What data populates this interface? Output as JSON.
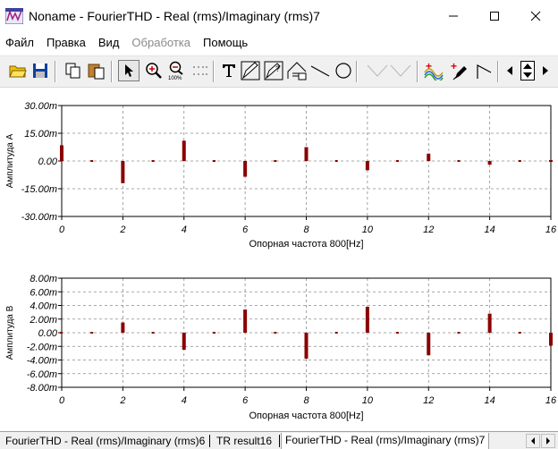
{
  "window": {
    "title": "Noname - FourierTHD - Real (rms)/Imaginary (rms)7",
    "minimize": "—",
    "maximize": "☐",
    "close": "✕"
  },
  "menu": {
    "items": [
      {
        "label": "Файл",
        "enabled": true
      },
      {
        "label": "Правка",
        "enabled": true
      },
      {
        "label": "Вид",
        "enabled": true
      },
      {
        "label": "Обработка",
        "enabled": false
      },
      {
        "label": "Помощь",
        "enabled": true
      }
    ]
  },
  "toolbar": {
    "buttons": [
      {
        "name": "open-icon"
      },
      {
        "name": "save-icon"
      },
      {
        "name": "copy-icon"
      },
      {
        "name": "paste-icon"
      },
      {
        "name": "pointer-icon",
        "pressed": true
      },
      {
        "name": "zoom-in-icon"
      },
      {
        "name": "zoom-100-icon"
      },
      {
        "name": "grid-icon"
      },
      {
        "name": "text-icon"
      },
      {
        "name": "pen-icon"
      },
      {
        "name": "pen-question-icon"
      },
      {
        "name": "curve-icon"
      },
      {
        "name": "line-icon"
      },
      {
        "name": "circle-icon"
      },
      {
        "name": "cursor-line-icon"
      },
      {
        "name": "cursor-line2-icon"
      },
      {
        "name": "add-trace-icon"
      },
      {
        "name": "add-marker-icon"
      },
      {
        "name": "step-icon"
      },
      {
        "name": "scroll-left-icon"
      },
      {
        "name": "scroll-updown-icon"
      },
      {
        "name": "scroll-right-icon"
      }
    ]
  },
  "chart_data": [
    {
      "type": "bar",
      "ylabel": "Амплитуда A",
      "xlabel": "Опорная частота 800[Hz]",
      "xlim": [
        0,
        16
      ],
      "ylim": [
        -0.03,
        0.03
      ],
      "x_ticks": [
        "0",
        "2",
        "4",
        "6",
        "8",
        "10",
        "12",
        "14",
        "16"
      ],
      "y_ticks": [
        "30.00m",
        "15.00m",
        "0.00",
        "-15.00m",
        "-30.00m"
      ],
      "y_tick_values": [
        0.03,
        0.015,
        0,
        -0.015,
        -0.03
      ],
      "grid": true,
      "color": "#8b0000",
      "x": [
        0,
        1,
        2,
        3,
        4,
        5,
        6,
        7,
        8,
        9,
        10,
        11,
        12,
        13,
        14,
        15,
        16
      ],
      "values": [
        0.0085,
        0,
        -0.012,
        0,
        0.011,
        0,
        -0.0085,
        0,
        0.0075,
        0,
        -0.005,
        0,
        0.004,
        0,
        -0.002,
        0,
        0.0005
      ]
    },
    {
      "type": "bar",
      "ylabel": "Амплитуда B",
      "xlabel": "Опорная частота 800[Hz]",
      "xlim": [
        0,
        16
      ],
      "ylim": [
        -0.008,
        0.008
      ],
      "x_ticks": [
        "0",
        "2",
        "4",
        "6",
        "8",
        "10",
        "12",
        "14",
        "16"
      ],
      "y_ticks": [
        "8.00m",
        "6.00m",
        "4.00m",
        "2.00m",
        "0.00",
        "-2.00m",
        "-4.00m",
        "-6.00m",
        "-8.00m"
      ],
      "y_tick_values": [
        0.008,
        0.006,
        0.004,
        0.002,
        0,
        -0.002,
        -0.004,
        -0.006,
        -0.008
      ],
      "grid": true,
      "color": "#8b0000",
      "x": [
        0,
        1,
        2,
        3,
        4,
        5,
        6,
        7,
        8,
        9,
        10,
        11,
        12,
        13,
        14,
        15,
        16
      ],
      "values": [
        0,
        0,
        0.0015,
        0,
        -0.0025,
        0,
        0.0034,
        0,
        -0.0038,
        0,
        0.0038,
        0,
        -0.0033,
        0,
        0.0028,
        0,
        -0.0019
      ]
    }
  ],
  "tabs": [
    {
      "label": "FourierTHD - Real (rms)/Imaginary (rms)6",
      "active": false
    },
    {
      "label": "TR result16",
      "active": false
    },
    {
      "label": "FourierTHD - Real (rms)/Imaginary (rms)7",
      "active": true
    }
  ]
}
